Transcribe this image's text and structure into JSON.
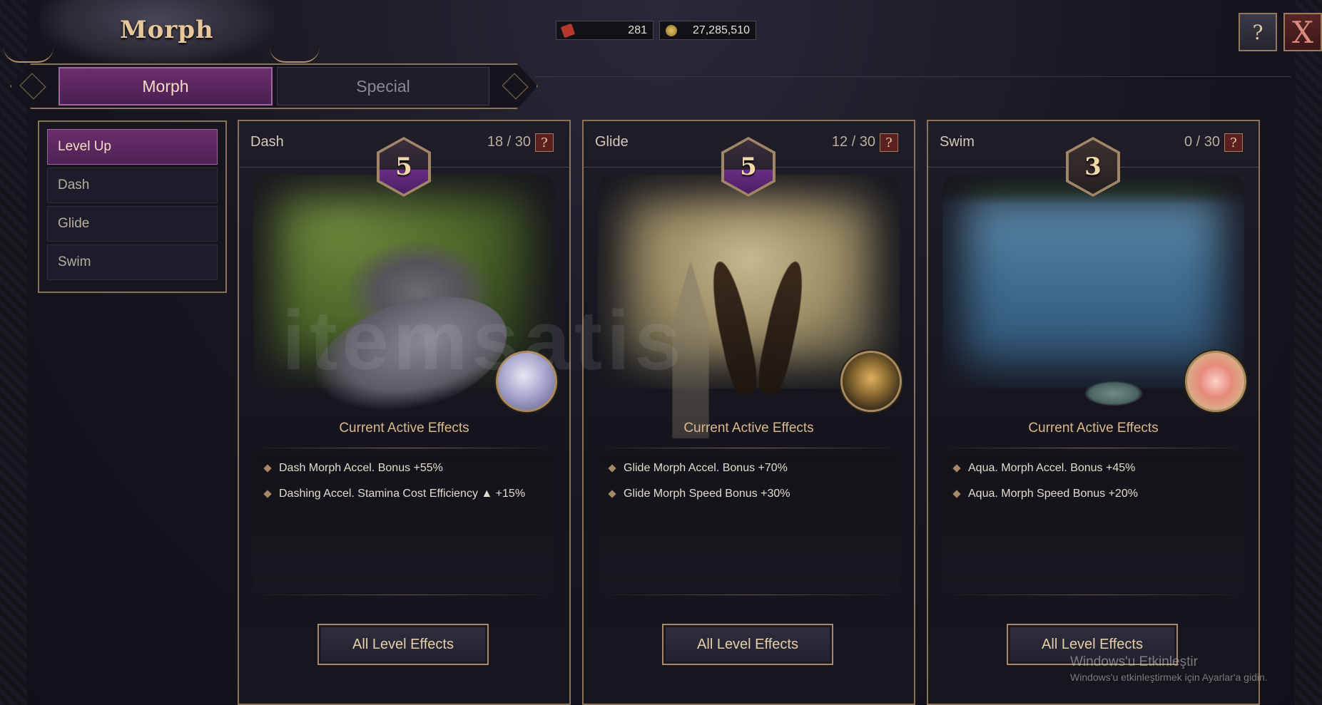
{
  "header": {
    "title": "Morph",
    "currencies": [
      {
        "icon": "red-token-icon",
        "value": "281"
      },
      {
        "icon": "gold-coin-icon",
        "value": "27,285,510"
      }
    ],
    "help_label": "?",
    "close_label": "X"
  },
  "tabs": [
    {
      "label": "Morph",
      "active": true
    },
    {
      "label": "Special",
      "active": false
    }
  ],
  "menu": {
    "items": [
      {
        "label": "Level Up",
        "active": true
      },
      {
        "label": "Dash",
        "active": false
      },
      {
        "label": "Glide",
        "active": false
      },
      {
        "label": "Swim",
        "active": false
      }
    ]
  },
  "cards": [
    {
      "name": "Dash",
      "count": "18 / 30",
      "level": "5",
      "portrait_icon": "wolf-portrait-icon",
      "effects_title": "Current Active Effects",
      "effects": [
        "Dash Morph Accel. Bonus +55%",
        "Dashing Accel. Stamina Cost Efficiency ▲ +15%"
      ],
      "button": "All Level Effects"
    },
    {
      "name": "Glide",
      "count": "12 / 30",
      "level": "5",
      "portrait_icon": "owl-portrait-icon",
      "effects_title": "Current Active Effects",
      "effects": [
        "Glide Morph Accel. Bonus +70%",
        "Glide Morph Speed Bonus  +30%"
      ],
      "button": "All Level Effects"
    },
    {
      "name": "Swim",
      "count": "0 / 30",
      "level": "3",
      "portrait_icon": "fish-portrait-icon",
      "effects_title": "Current Active Effects",
      "effects": [
        "Aqua. Morph Accel. Bonus +45%",
        "Aqua. Morph Speed Bonus +20%"
      ],
      "button": "All Level Effects"
    }
  ],
  "overlay": {
    "watermark": "itemsatis",
    "activation_title": "Windows'u Etkinleştir",
    "activation_sub": "Windows'u etkinleştirmek için Ayarlar'a gidin."
  },
  "colors": {
    "accent_purple": "#6a2e6c",
    "border_gold": "#8a7358",
    "text_gold": "#d9b88d"
  }
}
